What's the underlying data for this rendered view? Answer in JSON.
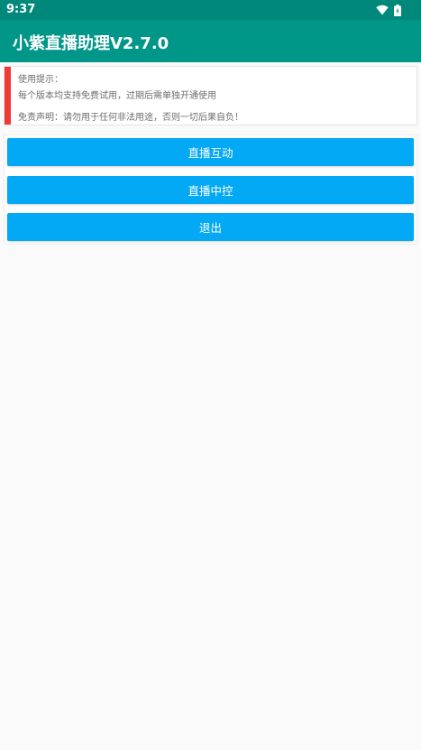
{
  "status_bar": {
    "time": "9:37",
    "icons": [
      "wifi-icon",
      "battery-icon"
    ]
  },
  "app_bar": {
    "title": "小紫直播助理V2.7.0",
    "color": "#009688"
  },
  "notice": {
    "line1": "使用提示：",
    "line2": "每个版本均支持免费试用，过期后需单独开通使用",
    "line3": "免责声明：请勿用于任何非法用途，否则一切后果自负！",
    "accent_color": "#ef3b35"
  },
  "buttons": {
    "live_interaction": "直播互动",
    "live_control": "直播中控",
    "exit": "退出",
    "color": "#03a9f4"
  }
}
